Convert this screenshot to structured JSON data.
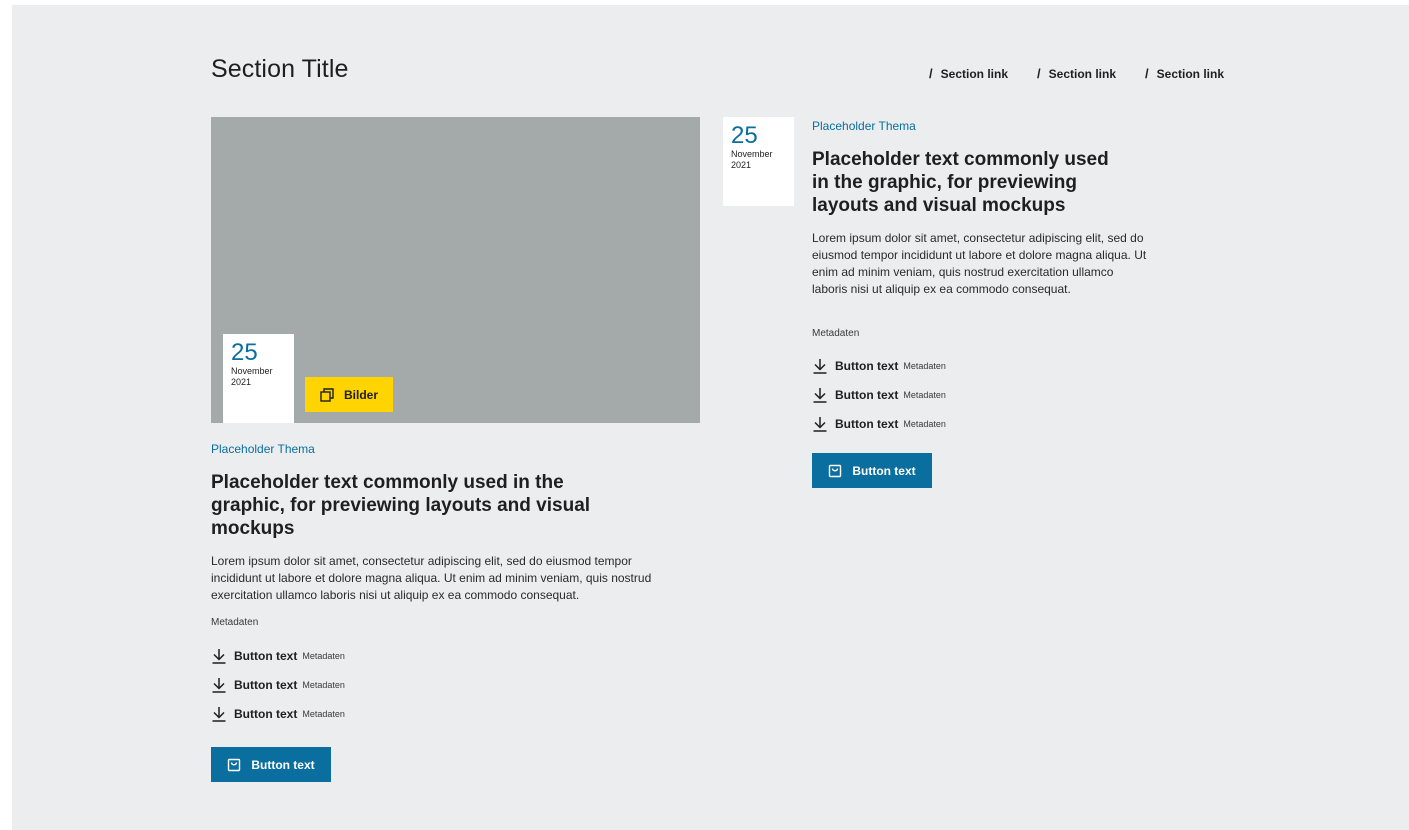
{
  "section": {
    "title": "Section Title",
    "links": [
      {
        "label": "Section link"
      },
      {
        "label": "Section link"
      },
      {
        "label": "Section link"
      }
    ]
  },
  "teaser_left": {
    "date": {
      "day": "25",
      "month": "November",
      "year": "2021"
    },
    "gallery_button": "Bilder",
    "topic": "Placeholder Thema",
    "headline": "Placeholder text commonly used in the graphic, for previewing layouts and visual mockups",
    "body": "Lorem ipsum dolor sit amet, consectetur adipiscing elit, sed do eiusmod tempor incididunt ut labore et dolore magna aliqua. Ut enim ad minim veniam, quis nostrud exercitation ullamco laboris nisi ut aliquip ex ea commodo consequat.",
    "meta": "Metadaten",
    "downloads": [
      {
        "label": "Button text",
        "meta": "Metadaten"
      },
      {
        "label": "Button text",
        "meta": "Metadaten"
      },
      {
        "label": "Button text",
        "meta": "Metadaten"
      }
    ],
    "button": "Button text"
  },
  "teaser_right": {
    "date": {
      "day": "25",
      "month": "November",
      "year": "2021"
    },
    "topic": "Placeholder Thema",
    "headline": "Placeholder text commonly used in the graphic, for previewing layouts and visual mockups",
    "body": "Lorem ipsum dolor sit amet, consectetur adipiscing elit, sed do eiusmod tempor incididunt ut labore et dolore magna aliqua. Ut enim ad minim veniam, quis nostrud exercitation ullamco laboris nisi ut aliquip ex ea commodo consequat.",
    "meta": "Metadaten",
    "downloads": [
      {
        "label": "Button text",
        "meta": "Metadaten"
      },
      {
        "label": "Button text",
        "meta": "Metadaten"
      },
      {
        "label": "Button text",
        "meta": "Metadaten"
      }
    ],
    "button": "Button text"
  },
  "icons": {
    "section_link": "slash-icon",
    "gallery": "gallery-icon",
    "download": "download-icon",
    "primary_button": "shopping-bag-icon"
  },
  "colors": {
    "background": "#ecedef",
    "accent": "#0a6e9e",
    "highlight": "#ffd400",
    "image_placeholder": "#a4a9aa"
  }
}
